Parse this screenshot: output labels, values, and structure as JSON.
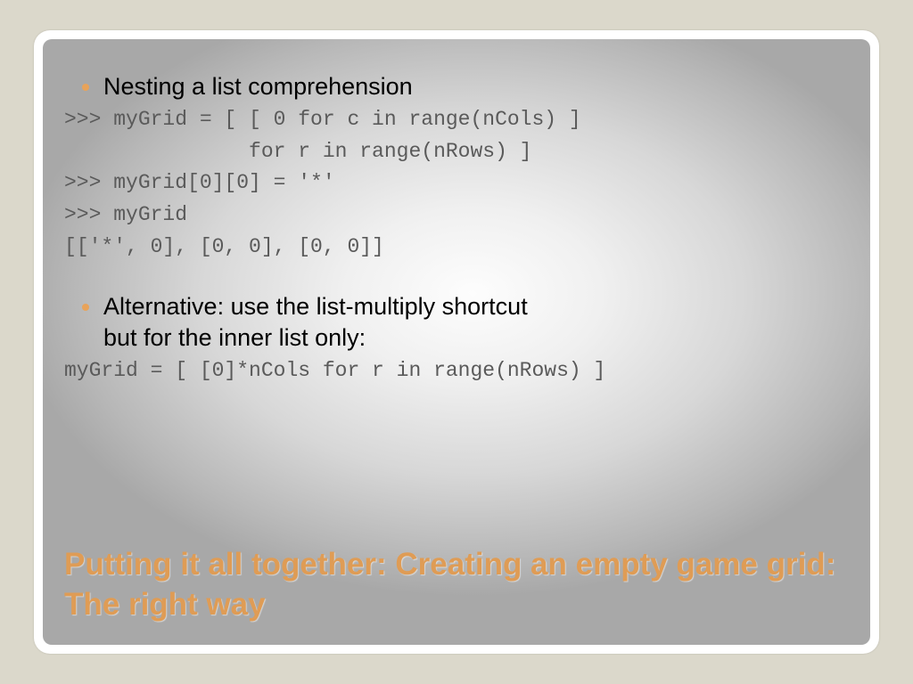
{
  "content": {
    "bullet1": "Nesting a list comprehension",
    "code1_line1": ">>> myGrid = [ [ 0 for c in range(nCols) ]",
    "code1_line2": "               for r in range(nRows) ]",
    "code1_line3": ">>> myGrid[0][0] = '*'",
    "code1_line4": ">>> myGrid",
    "code1_line5": "[['*', 0], [0, 0], [0, 0]]",
    "bullet2_line1": "Alternative: use the list-multiply shortcut",
    "bullet2_line2": "but for the inner list only:",
    "code2_line1": "myGrid = [ [0]*nCols for r in range(nRows) ]"
  },
  "title": "Putting it all together: Creating an empty game grid: The right way"
}
